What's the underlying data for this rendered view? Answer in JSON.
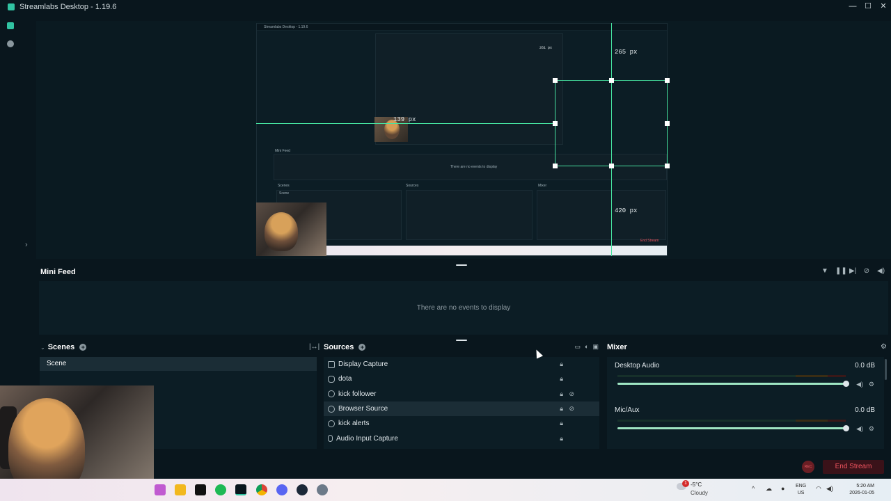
{
  "window": {
    "title": "Streamlabs Desktop - 1.19.6",
    "controls": [
      "—",
      "☐",
      "✕"
    ]
  },
  "preview": {
    "inner_title": "Streamlabs Desktop - 1.19.6",
    "labels": {
      "top": "265 px",
      "left": "139 px",
      "bottom": "420 px",
      "small_top": "261 px"
    },
    "inner_minifeed": "Mini Feed",
    "inner_no_events": "There are no events to display",
    "inner_scenes": "Scenes",
    "inner_sources": "Sources",
    "inner_mixer": "Mixer",
    "inner_scene_item": "Scene",
    "inner_end_stream": "End Stream"
  },
  "mini_feed": {
    "title": "Mini Feed",
    "empty": "There are no events to display",
    "tools": [
      "filter-icon",
      "pause-icon",
      "skip-icon",
      "mute-alerts-icon",
      "volume-icon"
    ]
  },
  "scenes": {
    "title": "Scenes",
    "items": [
      "Scene"
    ]
  },
  "sources": {
    "title": "Sources",
    "items": [
      {
        "label": "Display Capture",
        "icon": "monitor-icon",
        "eye": ""
      },
      {
        "label": "dota",
        "icon": "gamepad-icon",
        "eye": ""
      },
      {
        "label": "kick follower",
        "icon": "globe-icon",
        "eye": "⊘"
      },
      {
        "label": "Browser Source",
        "icon": "globe-icon",
        "eye": "⊘"
      },
      {
        "label": "kick alerts",
        "icon": "globe-icon",
        "eye": ""
      },
      {
        "label": "Audio Input Capture",
        "icon": "mic-icon",
        "eye": ""
      }
    ]
  },
  "mixer": {
    "title": "Mixer",
    "channels": [
      {
        "name": "Desktop Audio",
        "db": "0.0 dB",
        "level": 1.0
      },
      {
        "name": "Mic/Aux",
        "db": "0.0 dB",
        "level": 1.0
      }
    ]
  },
  "statusbar": {
    "rec_label": "REC",
    "end_stream": "End Stream"
  },
  "taskbar": {
    "weather": {
      "temp": "-5°C",
      "condition": "Cloudy",
      "badge": "1"
    },
    "lang_top": "ENG",
    "lang_bottom": "US",
    "time": "5:20 AM",
    "date": "2026-01-05"
  },
  "colors": {
    "accent": "#31c3a2",
    "guide": "#46e3a0",
    "end_stream": "#f0545f",
    "bg": "#09161d"
  }
}
